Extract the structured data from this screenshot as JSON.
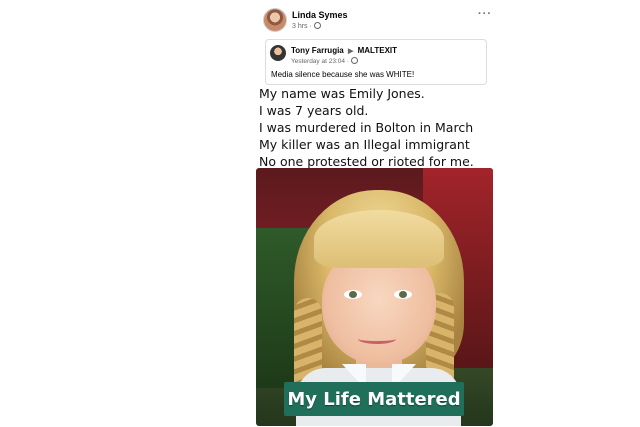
{
  "post": {
    "author": "Linda Symes",
    "meta": "3 hrs ·",
    "more_icon": "more-horizontal-icon"
  },
  "shared_post": {
    "author": "Tony Farrugia",
    "arrow": "▶",
    "group": "MALTEXIT",
    "meta": "Yesterday at 23:04 ·",
    "text": "Media silence because she was WHITE!"
  },
  "meme": {
    "lines": [
      "My name was Emily Jones.",
      "I was 7 years old.",
      "I was murdered in Bolton in March",
      "My killer was an Illegal  immigrant",
      "No one protested or rioted for me."
    ],
    "banner": "My Life Mattered"
  }
}
